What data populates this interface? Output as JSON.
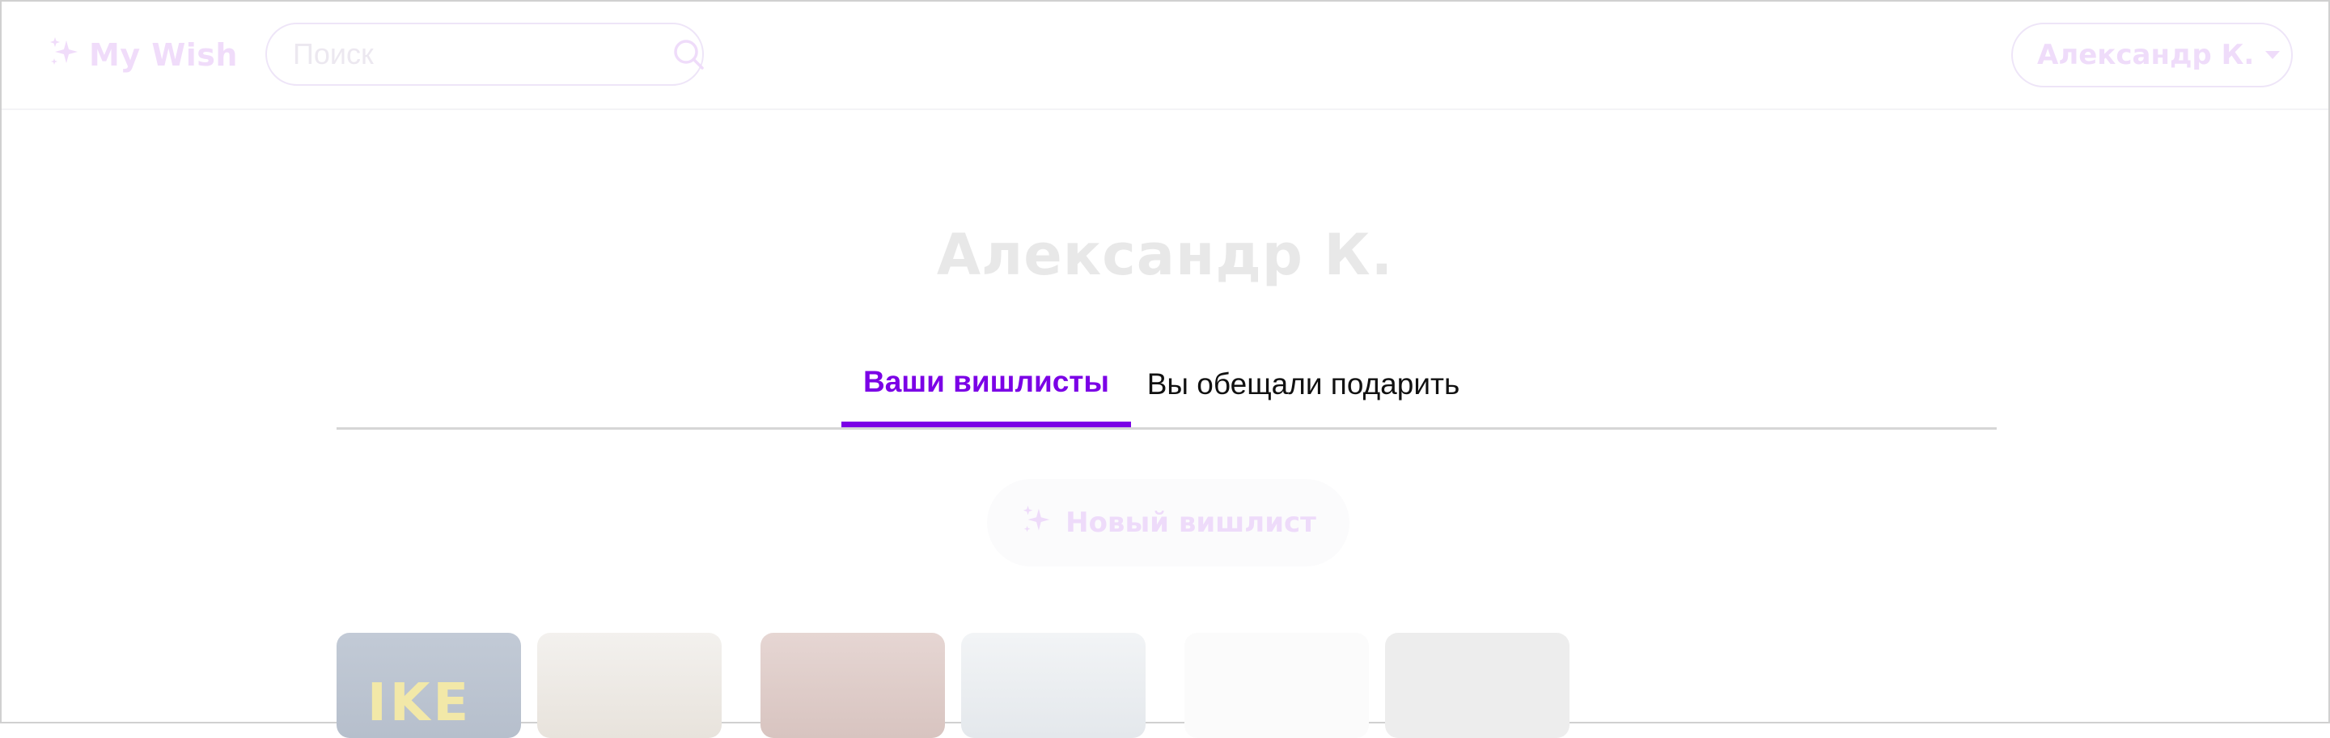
{
  "header": {
    "logo_text": "My Wish",
    "search_placeholder": "Поиск",
    "user_menu_label": "Александр К."
  },
  "profile": {
    "name": "Александр К."
  },
  "tabs": [
    {
      "label": "Ваши вишлисты",
      "active": true
    },
    {
      "label": "Вы обещали подарить",
      "active": false
    }
  ],
  "new_wishlist_button": "Новый вишлист",
  "wishlist_cards": [
    {
      "image": "ikea-store-photo"
    },
    {
      "image": "food-photo"
    },
    {
      "image": "person-photo"
    },
    {
      "image": "watch-photo"
    },
    {
      "image": "white-product-photo"
    },
    {
      "image": "dark-product-photo"
    }
  ],
  "colors": {
    "accent": "#7b00e6",
    "logo_faded": "#f0dcfa",
    "tab_underline": "#d6d6d6"
  }
}
